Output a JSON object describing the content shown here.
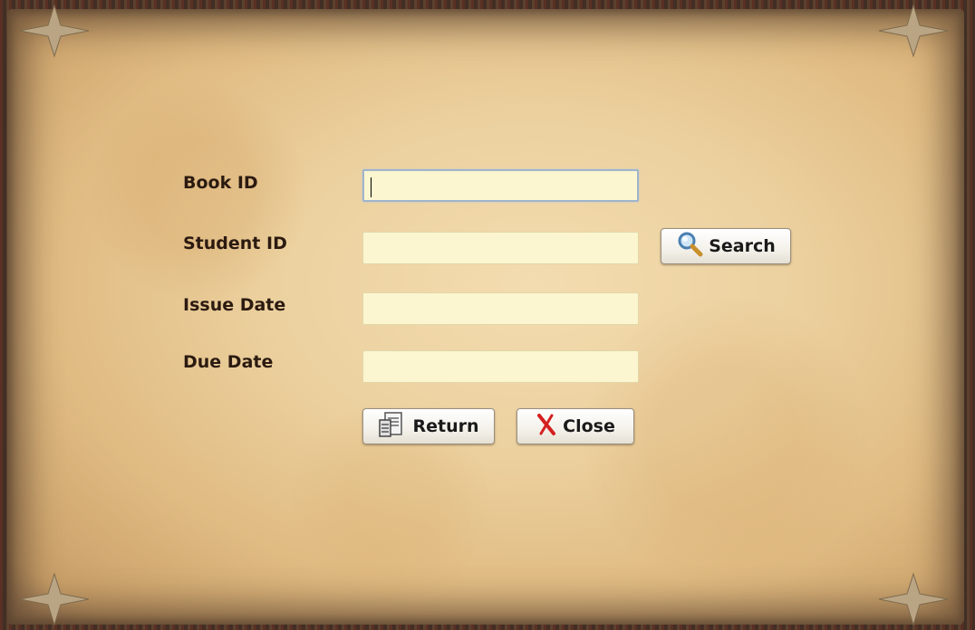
{
  "form": {
    "book_id_label": "Book ID",
    "student_id_label": "Student ID",
    "issue_date_label": "Issue Date",
    "due_date_label": "Due Date",
    "book_id_value": "",
    "student_id_value": "",
    "issue_date_value": "",
    "due_date_value": ""
  },
  "buttons": {
    "search_label": "Search",
    "return_label": "Return",
    "close_label": "Close"
  },
  "icons": {
    "search": "magnifier-icon",
    "return": "return-book-icon",
    "close": "red-x-icon",
    "decoration": "star-icon"
  },
  "colors": {
    "field_bg": "#fbf6cf",
    "parchment": "#ecd19f",
    "label_text": "#2b1a10",
    "close_x": "#d42020"
  }
}
